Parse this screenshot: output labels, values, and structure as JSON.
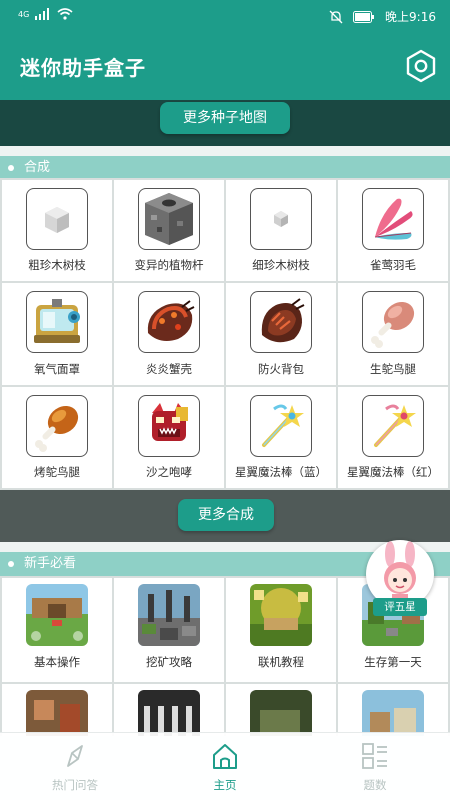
{
  "status": {
    "network": "4G",
    "time": "晚上9:16"
  },
  "header": {
    "title": "迷你助手盒子"
  },
  "seed_button": "更多种子地图",
  "synthesis": {
    "title": "合成",
    "items": [
      {
        "label": "粗珍木树枝",
        "icon": "pale-cube-icon"
      },
      {
        "label": "变异的植物杆",
        "icon": "stone-block-icon"
      },
      {
        "label": "细珍木树枝",
        "icon": "small-cube-icon"
      },
      {
        "label": "雀莺羽毛",
        "icon": "feather-icon"
      },
      {
        "label": "氧气面罩",
        "icon": "oxygen-mask-icon"
      },
      {
        "label": "炎炎蟹壳",
        "icon": "crab-shell-icon"
      },
      {
        "label": "防火背包",
        "icon": "fire-backpack-icon"
      },
      {
        "label": "生鸵鸟腿",
        "icon": "raw-drumstick-icon"
      },
      {
        "label": "烤鸵鸟腿",
        "icon": "roasted-drumstick-icon"
      },
      {
        "label": "沙之咆哮",
        "icon": "sand-roar-mask-icon"
      },
      {
        "label": "星翼魔法棒（蓝）",
        "icon": "wand-blue-icon"
      },
      {
        "label": "星翼魔法棒（红）",
        "icon": "wand-red-icon"
      }
    ]
  },
  "more_synthesis_button": "更多合成",
  "guide": {
    "title": "新手必看",
    "items": [
      {
        "label": "基本操作"
      },
      {
        "label": "挖矿攻略"
      },
      {
        "label": "联机教程"
      },
      {
        "label": "生存第一天"
      },
      {
        "label": ""
      },
      {
        "label": ""
      },
      {
        "label": ""
      },
      {
        "label": ""
      }
    ]
  },
  "rate_badge": "评五星",
  "bottom_nav": [
    {
      "label": "热门问答",
      "icon": "compass-icon",
      "active": false
    },
    {
      "label": "主页",
      "icon": "home-icon",
      "active": true
    },
    {
      "label": "题数",
      "icon": "grid-list-icon",
      "active": false
    }
  ],
  "colors": {
    "primary": "#1d9d8a",
    "dark_band": "#1a4842",
    "section_bar": "#8ed0c6"
  }
}
